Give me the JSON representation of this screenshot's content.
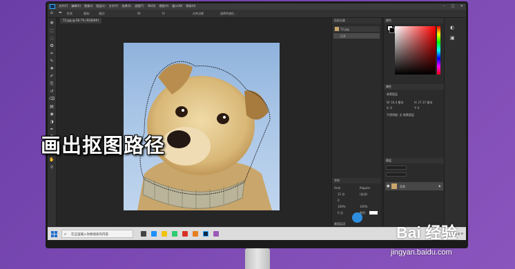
{
  "app": {
    "logo": "Ps",
    "menus": [
      "文件(F)",
      "编辑(E)",
      "图像(I)",
      "图层(L)",
      "文字(Y)",
      "选择(S)",
      "滤镜(T)",
      "3D(D)",
      "视图(V)",
      "窗口(W)",
      "帮助(H)"
    ],
    "window_controls": [
      "–",
      "□",
      "✕"
    ]
  },
  "options_bar": {
    "mode_label": "形状",
    "fill_label": "填充:",
    "stroke_label": "描边:",
    "width_label": "W:",
    "height_label": "H:",
    "align_label": "对齐边缘",
    "right_label": "选择并遮住..."
  },
  "document": {
    "tab_label": "72.jpg @ 66.7% (RGB/8#)"
  },
  "tools": [
    "move-tool",
    "marquee-tool",
    "lasso-tool",
    "quick-select-tool",
    "crop-tool",
    "eyedropper-tool",
    "healing-tool",
    "brush-tool",
    "stamp-tool",
    "history-brush-tool",
    "eraser-tool",
    "gradient-tool",
    "blur-tool",
    "dodge-tool",
    "pen-tool",
    "type-tool",
    "path-select-tool",
    "shape-tool",
    "hand-tool",
    "zoom-tool"
  ],
  "history_panel": {
    "title": "历史记录",
    "items": [
      "72.jpg",
      "打开"
    ]
  },
  "color_panel": {
    "title": "颜色"
  },
  "properties_panel": {
    "title": "属性",
    "subtitle": "像素图层",
    "w": "W: 16.4 厘米",
    "h": "H: 17.37 厘米",
    "x": "X: 0",
    "y": "Y: 0",
    "note": "不透明度: 无 像素图层"
  },
  "character_panel": {
    "title": "字符",
    "font": "Arial",
    "style": "Regular",
    "size": "12 点",
    "leading": "(自动)",
    "tracking": "0",
    "scale_v": "100%",
    "scale_h": "100%",
    "baseline": "0 点",
    "color_label": "颜色:",
    "language": "美国英语"
  },
  "layers_panel": {
    "title": "图层",
    "layer_name": "背景"
  },
  "status": {
    "zoom": "66.67%",
    "doc_size": "文档:1.05M/1.05M"
  },
  "taskbar": {
    "search_placeholder": "在这里输入你要搜索的内容"
  },
  "overlay": {
    "caption": "画出抠图路径",
    "watermark_main": "Bai 经验",
    "watermark_sub": "jingyan.baidu.com"
  }
}
